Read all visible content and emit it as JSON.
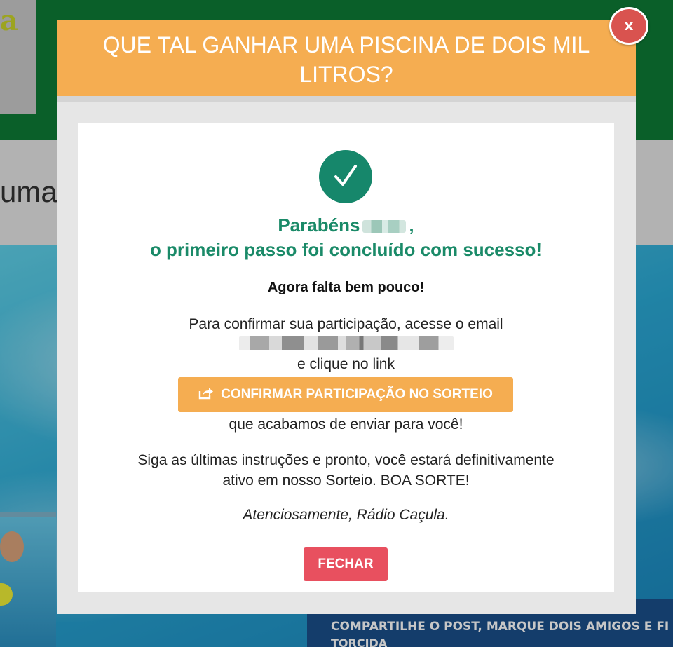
{
  "background": {
    "logo_text": "a",
    "subbar_text": "uma",
    "promo_lines": [
      "...",
      "COMPARTILHE O POST, MARQUE DOIS AMIGOS E FI",
      "TORCIDA"
    ]
  },
  "modal": {
    "title": "QUE TAL GANHAR UMA PISCINA DE DOIS MIL LITROS?",
    "close_label": "x",
    "congrats_prefix": "Parabéns",
    "congrats_suffix": ",",
    "congrats_line2": "o primeiro passo foi concluído com sucesso!",
    "almost_there": "Agora falta bem pouco!",
    "confirm_instruction": "Para confirmar sua participação, acesse o email",
    "click_link": "e clique no link",
    "confirm_button_label": "CONFIRMAR PARTICIPAÇÃO NO SORTEIO",
    "just_sent": "que acabamos de enviar para você!",
    "final_line1": "Siga as últimas instruções e pronto, você estará definitivamente",
    "final_line2": "ativo em nosso Sorteio. BOA SORTE!",
    "signature": "Atenciosamente, Rádio Caçula.",
    "close_button_label": "FECHAR"
  },
  "colors": {
    "header_orange": "#f5ad51",
    "success_green": "#1a8a68",
    "close_red": "#e8505f",
    "site_green": "#0d7a35"
  },
  "icons": [
    "check-icon",
    "share-external-icon"
  ]
}
